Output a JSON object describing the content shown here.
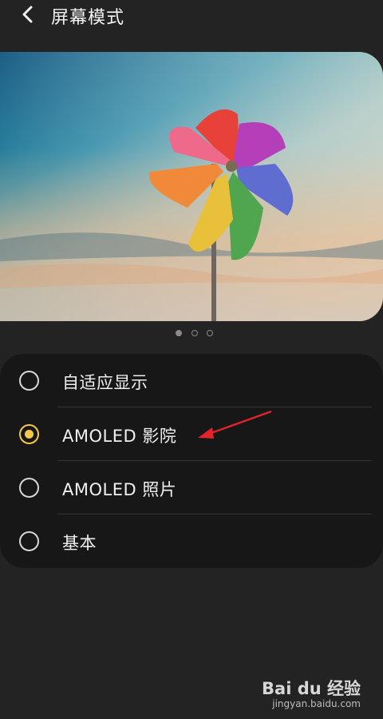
{
  "header": {
    "title": "屏幕模式",
    "back_icon": "chevron-left-icon"
  },
  "hero": {
    "image": "pinwheel-photo",
    "dot_count": 3,
    "active_dot": 0
  },
  "options": [
    {
      "label": "自适应显示",
      "selected": false
    },
    {
      "label": "AMOLED 影院",
      "selected": true
    },
    {
      "label": "AMOLED 照片",
      "selected": false
    },
    {
      "label": "基本",
      "selected": false
    }
  ],
  "colors": {
    "background": "#232323",
    "card": "#171717",
    "accent": "#f3c844",
    "annotation": "#e2232a"
  },
  "watermark": {
    "logo_text": "Bai du 经验",
    "url": "jingyan.baidu.com"
  }
}
